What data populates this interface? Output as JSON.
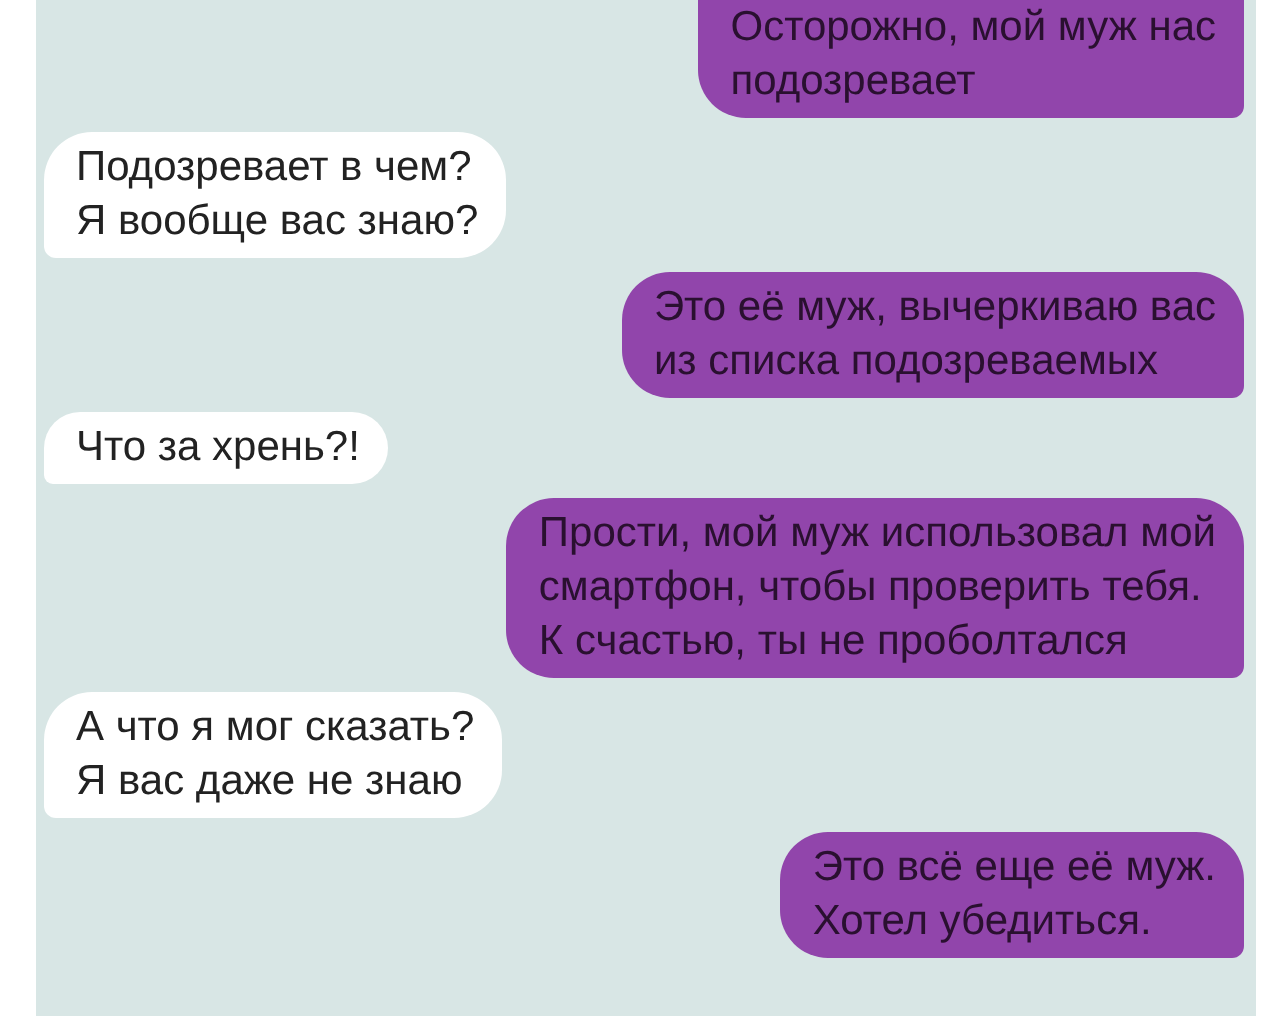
{
  "messages": [
    {
      "kind": "out",
      "text": "Осторожно, мой муж нас\nподозревает"
    },
    {
      "kind": "in",
      "text": "Подозревает в чем?\nЯ вообще вас знаю?"
    },
    {
      "kind": "out",
      "text": "Это её муж, вычеркиваю вас\nиз списка подозреваемых"
    },
    {
      "kind": "in",
      "text": "Что за хрень?!"
    },
    {
      "kind": "out",
      "text": "Прости, мой муж использовал мой\nсмартфон, чтобы проверить тебя.\nК счастью, ты не проболтался"
    },
    {
      "kind": "in",
      "text": "А что я мог сказать?\nЯ вас даже не знаю"
    },
    {
      "kind": "out",
      "text": "Это всё еще её муж.\nХотел убедиться."
    }
  ]
}
